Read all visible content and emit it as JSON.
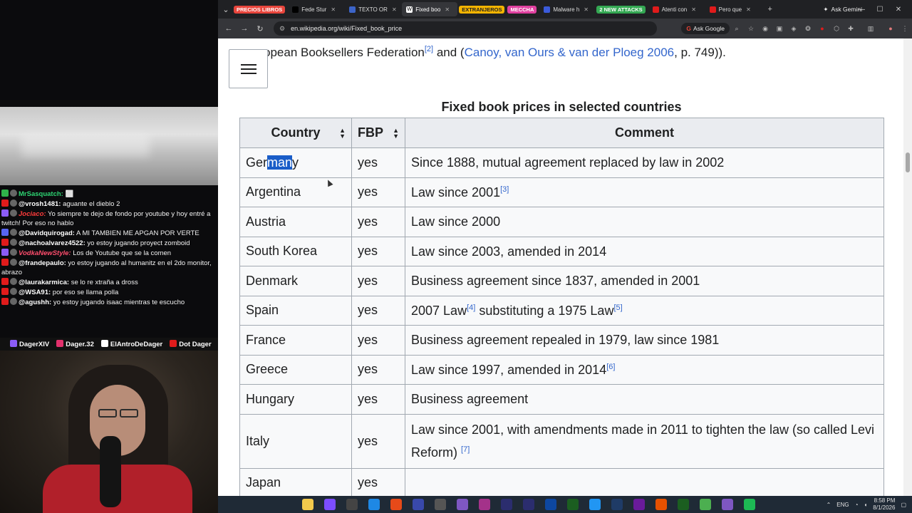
{
  "stream": {
    "chat": [
      {
        "badge": "sub",
        "name": "MrSasquatch:",
        "text": " ⬜",
        "style": "mr"
      },
      {
        "badge": "yt",
        "name": "@vrosh1481:",
        "text": " aguante el dieblo 2",
        "style": ""
      },
      {
        "badge": "tw",
        "name": "Jociaco:",
        "text": " Yo siempre te dejo de fondo por youtube y hoy entré a twitch! Por eso no hablo",
        "style": "red"
      },
      {
        "badge": "dc",
        "name": "@Davidquirogad:",
        "text": " A MI TAMBIEN ME APGAN POR VERTE",
        "style": ""
      },
      {
        "badge": "yt",
        "name": "@nachoalvarez4522:",
        "text": " yo estoy jugando proyect zomboid",
        "style": ""
      },
      {
        "badge": "tw",
        "name": "VodkaNewStyle:",
        "text": " Los de Youtube que se la comen",
        "style": "pink"
      },
      {
        "badge": "yt",
        "name": "@frandepaulo:",
        "text": " yo estoy jugando al humanitz en el 2do monitor, abrazo",
        "style": ""
      },
      {
        "badge": "yt",
        "name": "@laurakarmica:",
        "text": " se lo re xtraña a dross",
        "style": ""
      },
      {
        "badge": "yt",
        "name": "@WSA91:",
        "text": " por eso se llama polla",
        "style": ""
      },
      {
        "badge": "yt",
        "name": "@agushh:",
        "text": " yo estoy jugando isaac mientras te escucho",
        "style": ""
      }
    ],
    "socials": [
      {
        "label": "DagerXIV",
        "color": "#8b5cf6"
      },
      {
        "label": "Dager.32",
        "color": "#e1306c"
      },
      {
        "label": "ElAntroDeDager",
        "color": "#ffffff"
      },
      {
        "label": "Dot Dager",
        "color": "#e01b1b"
      }
    ]
  },
  "browser": {
    "tabs": [
      {
        "label": "PRECIOS LIBROS",
        "group": true,
        "color": "#e8453c"
      },
      {
        "label": "Fede Stur",
        "icon": "x-icon",
        "color": "#000000"
      },
      {
        "label": "TEXTO OR",
        "icon": "generic-icon",
        "color": "#3c64c8"
      },
      {
        "label": "Fixed boo",
        "icon": "wikipedia-icon",
        "color": "#ffffff",
        "active": true
      },
      {
        "label": "EXTRANJEROS",
        "group": true,
        "color": "#f4b400"
      },
      {
        "label": "MECCHA",
        "group": true,
        "color": "#e040a0"
      },
      {
        "label": "Malware h",
        "icon": "malware-icon",
        "color": "#3b5bdb"
      },
      {
        "label": "2 NEW ATTACKS",
        "group": true,
        "color": "#34a853"
      },
      {
        "label": "Atenti con",
        "icon": "youtube-icon",
        "color": "#e01b1b"
      },
      {
        "label": "Pero que",
        "icon": "youtube-icon",
        "color": "#e01b1b"
      }
    ],
    "ask_gemini": "Ask Gemini",
    "url": "en.wikipedia.org/wiki/Fixed_book_price",
    "ask_google": "Ask Google"
  },
  "page": {
    "prev_line_prefix": "opean Booksellers Federation",
    "prev_ref": "[2]",
    "prev_mid": " and (",
    "prev_link": "Canoy, van Ours & van der Ploeg 2006",
    "prev_suffix": ", p. 749)).",
    "table_caption": "Fixed book prices in selected countries",
    "headers": [
      "Country",
      "FBP",
      "Comment"
    ],
    "rows": [
      {
        "country_pre": "Ger",
        "country_hl": "man",
        "country_post": "y",
        "fbp": "yes",
        "comment": "Since 1888, mutual agreement replaced by law in 2002",
        "refs": []
      },
      {
        "country": "Argentina",
        "fbp": "yes",
        "comment": "Law since 2001",
        "refs": [
          "[3]"
        ]
      },
      {
        "country": "Austria",
        "fbp": "yes",
        "comment": "Law since 2000",
        "refs": []
      },
      {
        "country": "South Korea",
        "fbp": "yes",
        "comment": "Law since 2003, amended in 2014",
        "refs": []
      },
      {
        "country": "Denmark",
        "fbp": "yes",
        "comment": "Business agreement since 1837, amended in 2001",
        "refs": []
      },
      {
        "country": "Spain",
        "fbp": "yes",
        "comment_a": "2007 Law",
        "ref_a": "[4]",
        "comment_b": " substituting a 1975 Law",
        "ref_b": "[5]"
      },
      {
        "country": "France",
        "fbp": "yes",
        "comment": "Business agreement repealed in 1979, law since 1981",
        "refs": []
      },
      {
        "country": "Greece",
        "fbp": "yes",
        "comment": "Law since 1997, amended in 2014",
        "refs": [
          "[6]"
        ]
      },
      {
        "country": "Hungary",
        "fbp": "yes",
        "comment": "Business agreement",
        "refs": []
      },
      {
        "country": "Italy",
        "fbp": "yes",
        "comment": "Law since 2001, with amendments made in 2011 to tighten the law (so called Levi Reform) ",
        "refs": [
          "[7]"
        ]
      },
      {
        "country": "Japan",
        "fbp": "yes",
        "comment": "",
        "refs": []
      }
    ]
  },
  "taskbar": {
    "icons": [
      "#f2c94c",
      "#7c4dff",
      "#444444",
      "#1e88e5",
      "#e64a19",
      "#3949ab",
      "#555555",
      "#7e57c2",
      "#a4328a",
      "#2b2d6e",
      "#2b2d6e",
      "#0d47a1",
      "#1b5e20",
      "#2196f3",
      "#1f3b66",
      "#6a1b9a",
      "#e65100",
      "#1b5e20",
      "#4caf50",
      "#7e57c2",
      "#1db954"
    ],
    "lang": "ENG",
    "time": "8:58 PM",
    "date": "8/1/2026"
  }
}
